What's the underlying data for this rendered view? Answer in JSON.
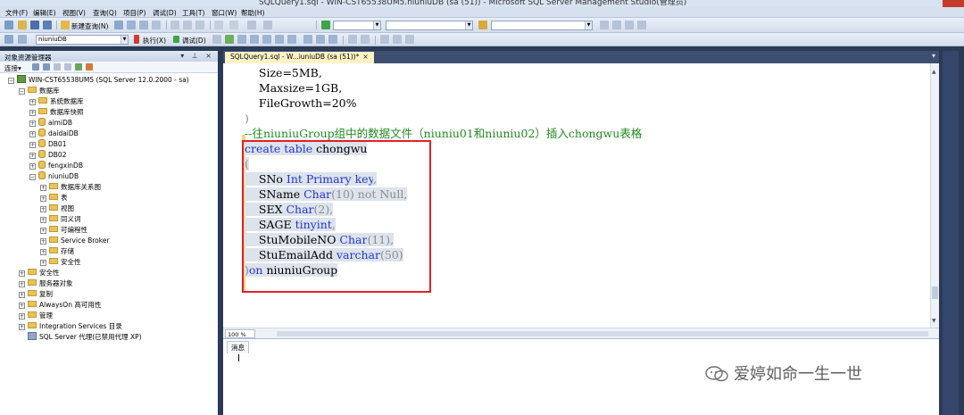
{
  "window": {
    "title": "SQLQuery1.sql - WIN-CST65538UM5.niuniuDB (sa (51)) - Microsoft SQL Server Management Studio(管理员)"
  },
  "menu": [
    "文件(F)",
    "编辑(E)",
    "视图(V)",
    "查询(Q)",
    "项目(P)",
    "调试(D)",
    "工具(T)",
    "窗口(W)",
    "帮助(H)"
  ],
  "toolbar": {
    "new_query": "新建查询(N)",
    "database": "niuniuDB",
    "execute": "执行(X)",
    "debug": "调试(D)"
  },
  "explorer": {
    "title": "对象资源管理器",
    "connect": "连接▾",
    "tree": [
      {
        "label": "WIN-CST65538UM5 (SQL Server 12.0.2000 - sa)",
        "expand": "−",
        "icon": "server"
      },
      {
        "label": "数据库",
        "expand": "−",
        "icon": "folder"
      },
      {
        "label": "系统数据库",
        "expand": "+",
        "icon": "folder"
      },
      {
        "label": "数据库快照",
        "expand": "+",
        "icon": "folder"
      },
      {
        "label": "aimiDB",
        "expand": "+",
        "icon": "db"
      },
      {
        "label": "daidaiDB",
        "expand": "+",
        "icon": "db"
      },
      {
        "label": "DB01",
        "expand": "+",
        "icon": "db"
      },
      {
        "label": "DB02",
        "expand": "+",
        "icon": "db"
      },
      {
        "label": "fengxinDB",
        "expand": "+",
        "icon": "db"
      },
      {
        "label": "niuniuDB",
        "expand": "−",
        "icon": "db"
      },
      {
        "label": "数据库关系图",
        "expand": "+",
        "icon": "folder"
      },
      {
        "label": "表",
        "expand": "+",
        "icon": "folder"
      },
      {
        "label": "视图",
        "expand": "+",
        "icon": "folder"
      },
      {
        "label": "同义词",
        "expand": "+",
        "icon": "folder"
      },
      {
        "label": "可编程性",
        "expand": "+",
        "icon": "folder"
      },
      {
        "label": "Service Broker",
        "expand": "+",
        "icon": "folder"
      },
      {
        "label": "存储",
        "expand": "+",
        "icon": "folder"
      },
      {
        "label": "安全性",
        "expand": "+",
        "icon": "folder"
      },
      {
        "label": "安全性",
        "expand": "+",
        "icon": "folder"
      },
      {
        "label": "服务器对象",
        "expand": "+",
        "icon": "folder"
      },
      {
        "label": "复制",
        "expand": "+",
        "icon": "folder"
      },
      {
        "label": "AlwaysOn 高可用性",
        "expand": "+",
        "icon": "folder"
      },
      {
        "label": "管理",
        "expand": "+",
        "icon": "folder"
      },
      {
        "label": "Integration Services 目录",
        "expand": "+",
        "icon": "folder"
      },
      {
        "label": "SQL Server 代理(已禁用代理 XP)",
        "expand": "",
        "icon": "agent"
      }
    ]
  },
  "editor": {
    "tab_label": "SQLQuery1.sql - W...iuniuDB (sa (51))*",
    "tab_close": "×",
    "code": {
      "l1": "Size=5MB,",
      "l2": "Maxsize=1GB,",
      "l3": "FileGrowth=20%",
      "l4": ")",
      "l5": "--往niuniuGroup组中的数据文件（niuniu01和niuniu02）插入chongwu表格",
      "l6_kw": "create table",
      "l6_name": " chongwu",
      "l7": "(",
      "c1_name": "SNo ",
      "c1_type": "Int Primary key",
      "c2_name": "SName ",
      "c2_type": "Char",
      "c2_len": "(10)",
      "c2_null": " not Null",
      "c3_name": "SEX ",
      "c3_type": "Char",
      "c3_len": "(2)",
      "c4_name": "SAGE ",
      "c4_type": "tinyint",
      "c5_name": "StuMobileNO ",
      "c5_type": "Char",
      "c5_len": "(11)",
      "c6_name": "StuEmailAdd ",
      "c6_type": "varchar",
      "c6_len": "(50)",
      "comma": ",",
      "end_paren": ")",
      "end_kw": "on",
      "end_name": " niuniuGroup"
    },
    "zoom": "100 %"
  },
  "results": {
    "tab_label": "消息"
  },
  "watermark": "爱婷如命一生一世",
  "colors": {
    "keyword": "#1f36d6",
    "comment": "#218a1f",
    "annotation_box": "#e0202a",
    "gray_punct": "#8d8d8d"
  }
}
